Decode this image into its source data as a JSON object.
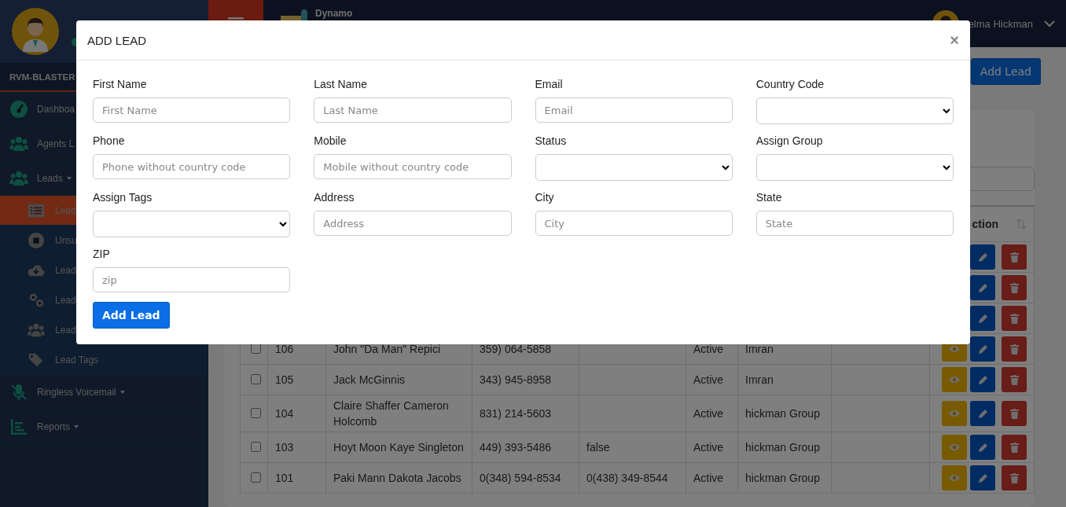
{
  "sidebar": {
    "app_name": "RVM-BLASTER",
    "items": [
      {
        "label": "Dashboa"
      },
      {
        "label": "Agents L"
      },
      {
        "label": "Leads",
        "dropdown": true,
        "children": [
          {
            "label": "Lead",
            "selected": true
          },
          {
            "label": "Unsu",
            "selected": false
          },
          {
            "label": "Lead",
            "selected": false
          },
          {
            "label": "Lead",
            "selected": false
          },
          {
            "label": "Lead",
            "selected": false
          },
          {
            "label": "Lead Tags",
            "selected": false
          }
        ]
      },
      {
        "label": "Ringless Voicemail",
        "dropdown": true
      },
      {
        "label": "Reports",
        "dropdown": true
      }
    ]
  },
  "topbar": {
    "logo": "Dynamo",
    "user_name": "elma Hickman"
  },
  "page": {
    "add_button": "Add Lead",
    "table": {
      "action_column": "ction",
      "rows": [
        {
          "actions": [
            {
              "kind": "edit"
            },
            {
              "kind": "delete"
            }
          ]
        },
        {
          "actions": [
            {
              "kind": "edit"
            },
            {
              "kind": "delete"
            }
          ]
        },
        {
          "actions": [
            {
              "kind": "edit"
            },
            {
              "kind": "delete"
            }
          ]
        },
        {
          "checked": false,
          "id": "106",
          "name": "John \"Da Man\" Repici",
          "phone": "359) 064-5858",
          "status": "Active",
          "group": "Imran",
          "actions": [
            {
              "kind": "view"
            },
            {
              "kind": "edit"
            },
            {
              "kind": "delete"
            }
          ]
        },
        {
          "checked": false,
          "id": "105",
          "name": "Jack McGinnis",
          "phone": "343) 945-8958",
          "status": "Active",
          "group": "Imran",
          "actions": [
            {
              "kind": "view"
            },
            {
              "kind": "edit"
            },
            {
              "kind": "delete"
            }
          ]
        },
        {
          "checked": false,
          "id": "104",
          "name": "Claire Shaffer Cameron Holcomb",
          "phone": "831) 214-5603",
          "status": "Active",
          "group": "hickman Group",
          "actions": [
            {
              "kind": "view"
            },
            {
              "kind": "edit"
            },
            {
              "kind": "delete"
            }
          ]
        },
        {
          "checked": false,
          "id": "103",
          "name": "Hoyt Moon Kaye Singleton",
          "phone": "449) 393-5486",
          "mobile": "false",
          "status": "Active",
          "group": "hickman Group",
          "actions": [
            {
              "kind": "view"
            },
            {
              "kind": "edit"
            },
            {
              "kind": "delete"
            }
          ]
        },
        {
          "checked": false,
          "id": "101",
          "name": "Paki Mann Dakota Jacobs",
          "phone": "0(348) 594-8534",
          "mobile": "0(438) 349-8544",
          "status": "Active",
          "group": "hickman Group",
          "actions": [
            {
              "kind": "view"
            },
            {
              "kind": "edit"
            },
            {
              "kind": "delete"
            }
          ]
        }
      ]
    }
  },
  "modal": {
    "title": "ADD LEAD",
    "close": "×",
    "fields": [
      {
        "label": "First Name",
        "kind": "text",
        "placeholder": "First Name"
      },
      {
        "label": "Last Name",
        "kind": "text",
        "placeholder": "Last Name"
      },
      {
        "label": "Email",
        "kind": "text",
        "placeholder": "Email"
      },
      {
        "label": "Country Code",
        "kind": "select"
      },
      {
        "label": "Phone",
        "kind": "text",
        "placeholder": "Phone without country code"
      },
      {
        "label": "Mobile",
        "kind": "text",
        "placeholder": "Mobile without country code"
      },
      {
        "label": "Status",
        "kind": "select"
      },
      {
        "label": "Assign Group",
        "kind": "select"
      },
      {
        "label": "Assign Tags",
        "kind": "select"
      },
      {
        "label": "Address",
        "kind": "text",
        "placeholder": "Address"
      },
      {
        "label": "City",
        "kind": "text",
        "placeholder": "City"
      },
      {
        "label": "State",
        "kind": "text",
        "placeholder": "State"
      },
      {
        "label": "ZIP",
        "kind": "text",
        "placeholder": "zip"
      }
    ],
    "submit": "Add Lead"
  }
}
